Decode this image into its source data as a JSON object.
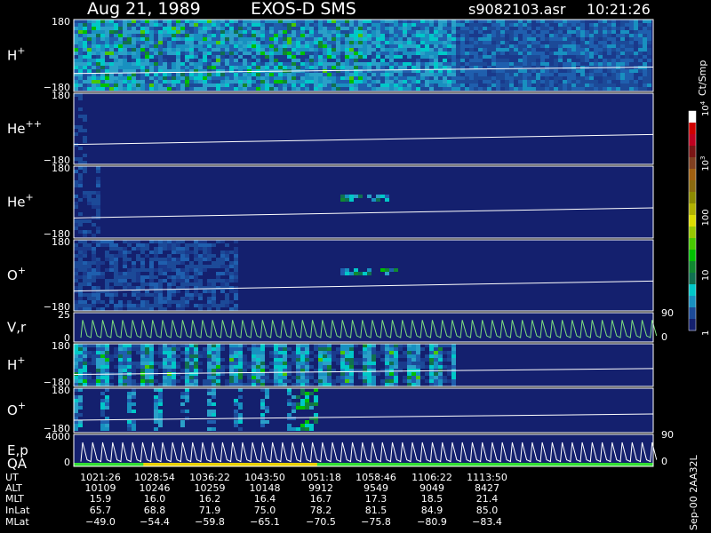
{
  "header": {
    "date": "Aug 21, 1989",
    "instrument": "EXOS-D SMS",
    "file": "s9082103.asr",
    "time": "10:21:26"
  },
  "colors": {
    "background": "#000000",
    "panel_fill": "#14206e",
    "trace": "#ffffff",
    "velocity_trace": "#7ee07e",
    "qa_green": "#33dd33",
    "qa_yellow": "#e8d000"
  },
  "chart_data": [
    {
      "type": "heatmap",
      "label": "H",
      "label_sup": "+",
      "ylim": [
        -180,
        180
      ],
      "tick_top": "180",
      "tick_bottom": "−180",
      "activity": "high"
    },
    {
      "type": "heatmap",
      "label": "He",
      "label_sup": "++",
      "ylim": [
        -180,
        180
      ],
      "tick_top": "180",
      "tick_bottom": "−180",
      "activity": "none"
    },
    {
      "type": "heatmap",
      "label": "He",
      "label_sup": "+",
      "ylim": [
        -180,
        180
      ],
      "tick_top": "180",
      "tick_bottom": "−180",
      "activity": "sparse"
    },
    {
      "type": "heatmap",
      "label": "O",
      "label_sup": "+",
      "ylim": [
        -180,
        180
      ],
      "tick_top": "180",
      "tick_bottom": "−180",
      "activity": "early"
    },
    {
      "type": "line",
      "label": "V,r",
      "ylim": [
        0,
        25
      ],
      "tick_top": "25",
      "tick_bottom": "0",
      "right_ticks": [
        "90",
        "0"
      ]
    },
    {
      "type": "heatmap",
      "label": "H",
      "label_sup": "+",
      "ylim": [
        -180,
        180
      ],
      "tick_top": "180",
      "tick_bottom": "−180",
      "activity": "striped"
    },
    {
      "type": "heatmap",
      "label": "O",
      "label_sup": "+",
      "ylim": [
        -180,
        180
      ],
      "tick_top": "180",
      "tick_bottom": "−180",
      "activity": "striped-sparse"
    },
    {
      "type": "line",
      "label": "E,p",
      "label2": "QA",
      "ylim": [
        0,
        4000
      ],
      "tick_top": "4000",
      "tick_bottom": "0",
      "right_ticks": [
        "90",
        "0"
      ]
    }
  ],
  "colorbar": {
    "title": "Ct/Smp",
    "scale": "log",
    "range": [
      1,
      10000
    ],
    "ticks": [
      {
        "base": "10",
        "exp": "4"
      },
      {
        "base": "10",
        "exp": "3"
      },
      {
        "base": "100",
        "exp": ""
      },
      {
        "base": "10",
        "exp": ""
      },
      {
        "base": "1",
        "exp": ""
      }
    ],
    "colors": [
      "#ffffff",
      "#d00000",
      "#c00020",
      "#7a1515",
      "#804020",
      "#a06010",
      "#8a6a10",
      "#8c8a00",
      "#b0b000",
      "#dcdc00",
      "#98c800",
      "#48c800",
      "#00c000",
      "#108830",
      "#107050",
      "#00c8c8",
      "#1890c0",
      "#1c4a98",
      "#14206e"
    ]
  },
  "axis_table": {
    "rows": [
      {
        "label": "UT",
        "values": [
          "1021:26",
          "1028:54",
          "1036:22",
          "1043:50",
          "1051:18",
          "1058:46",
          "1106:22",
          "1113:50"
        ]
      },
      {
        "label": "ALT",
        "values": [
          "10109",
          "10246",
          "10259",
          "10148",
          "9912",
          "9549",
          "9049",
          "8427"
        ]
      },
      {
        "label": "MLT",
        "values": [
          "15.9",
          "16.0",
          "16.2",
          "16.4",
          "16.7",
          "17.3",
          "18.5",
          "21.4"
        ]
      },
      {
        "label": "InLat",
        "values": [
          "65.7",
          "68.8",
          "71.9",
          "75.0",
          "78.2",
          "81.5",
          "84.9",
          "85.0"
        ]
      },
      {
        "label": "MLat",
        "values": [
          "−49.0",
          "−54.4",
          "−59.8",
          "−65.1",
          "−70.5",
          "−75.8",
          "−80.9",
          "−83.4"
        ]
      }
    ]
  },
  "footer": {
    "version": "Sep-00 2AA32L"
  }
}
